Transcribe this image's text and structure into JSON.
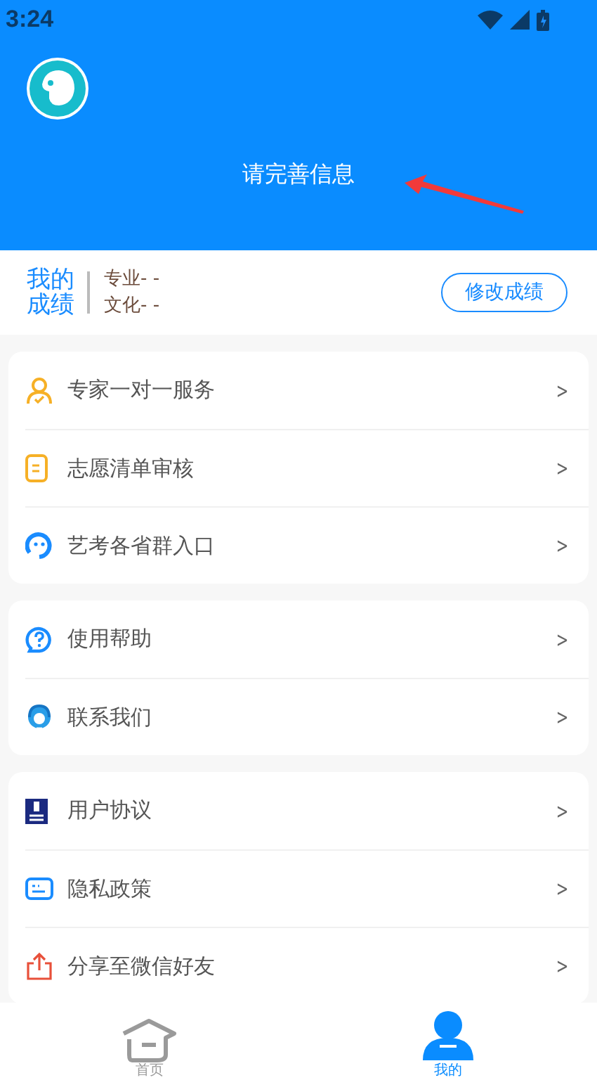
{
  "status_bar": {
    "time": "3:24"
  },
  "header": {
    "title": "请完善信息"
  },
  "scores": {
    "label_line1": "我的",
    "label_line2": "成绩",
    "major": "专业- -",
    "culture": "文化- -",
    "edit_button": "修改成绩"
  },
  "menu_groups": [
    {
      "items": [
        {
          "kind": "expert",
          "label": "专家一对一服务",
          "chevron": ">"
        },
        {
          "kind": "checklist",
          "label": "志愿清单审核",
          "chevron": ">"
        },
        {
          "kind": "group",
          "label": "艺考各省群入口",
          "chevron": ">"
        }
      ]
    },
    {
      "items": [
        {
          "kind": "help",
          "label": "使用帮助",
          "chevron": ">"
        },
        {
          "kind": "contact",
          "label": "联系我们",
          "chevron": ">"
        }
      ]
    },
    {
      "items": [
        {
          "kind": "agreement",
          "label": "用户协议",
          "chevron": ">"
        },
        {
          "kind": "privacy",
          "label": "隐私政策",
          "chevron": ">"
        },
        {
          "kind": "share",
          "label": "分享至微信好友",
          "chevron": ">"
        }
      ]
    }
  ],
  "tabs": [
    {
      "kind": "home",
      "label": "首页",
      "selected": false
    },
    {
      "kind": "me",
      "label": "我的",
      "selected": true
    }
  ]
}
